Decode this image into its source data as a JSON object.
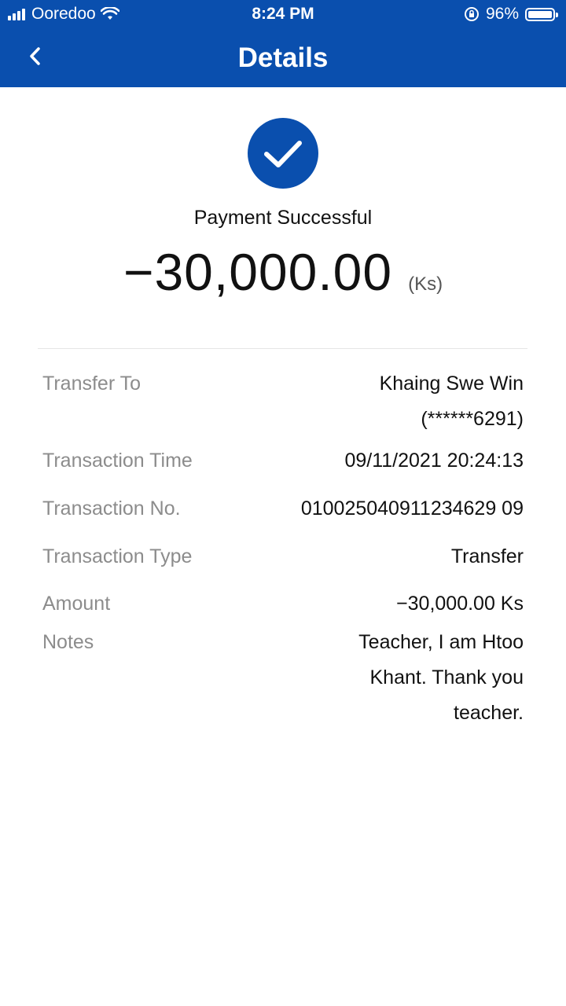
{
  "status_bar": {
    "carrier": "Ooredoo",
    "time": "8:24 PM",
    "battery": "96%"
  },
  "nav": {
    "title": "Details"
  },
  "result": {
    "status": "Payment Successful",
    "amount": "−30,000.00",
    "currency": "(Ks)"
  },
  "details": {
    "transfer_to_label": "Transfer To",
    "transfer_to_name": "Khaing Swe Win",
    "transfer_to_account": "(******6291)",
    "time_label": "Transaction Time",
    "time_value": "09/11/2021 20:24:13",
    "number_label": "Transaction No.",
    "number_value": "010025040911234629 09",
    "type_label": "Transaction Type",
    "type_value": "Transfer",
    "amount_label": "Amount",
    "amount_value": "−30,000.00 Ks",
    "notes_label": "Notes",
    "notes_line1": "Teacher, I am Htoo",
    "notes_line2": "Khant. Thank you",
    "notes_line3": "teacher."
  },
  "colors": {
    "brand_blue": "#0a4fae"
  }
}
